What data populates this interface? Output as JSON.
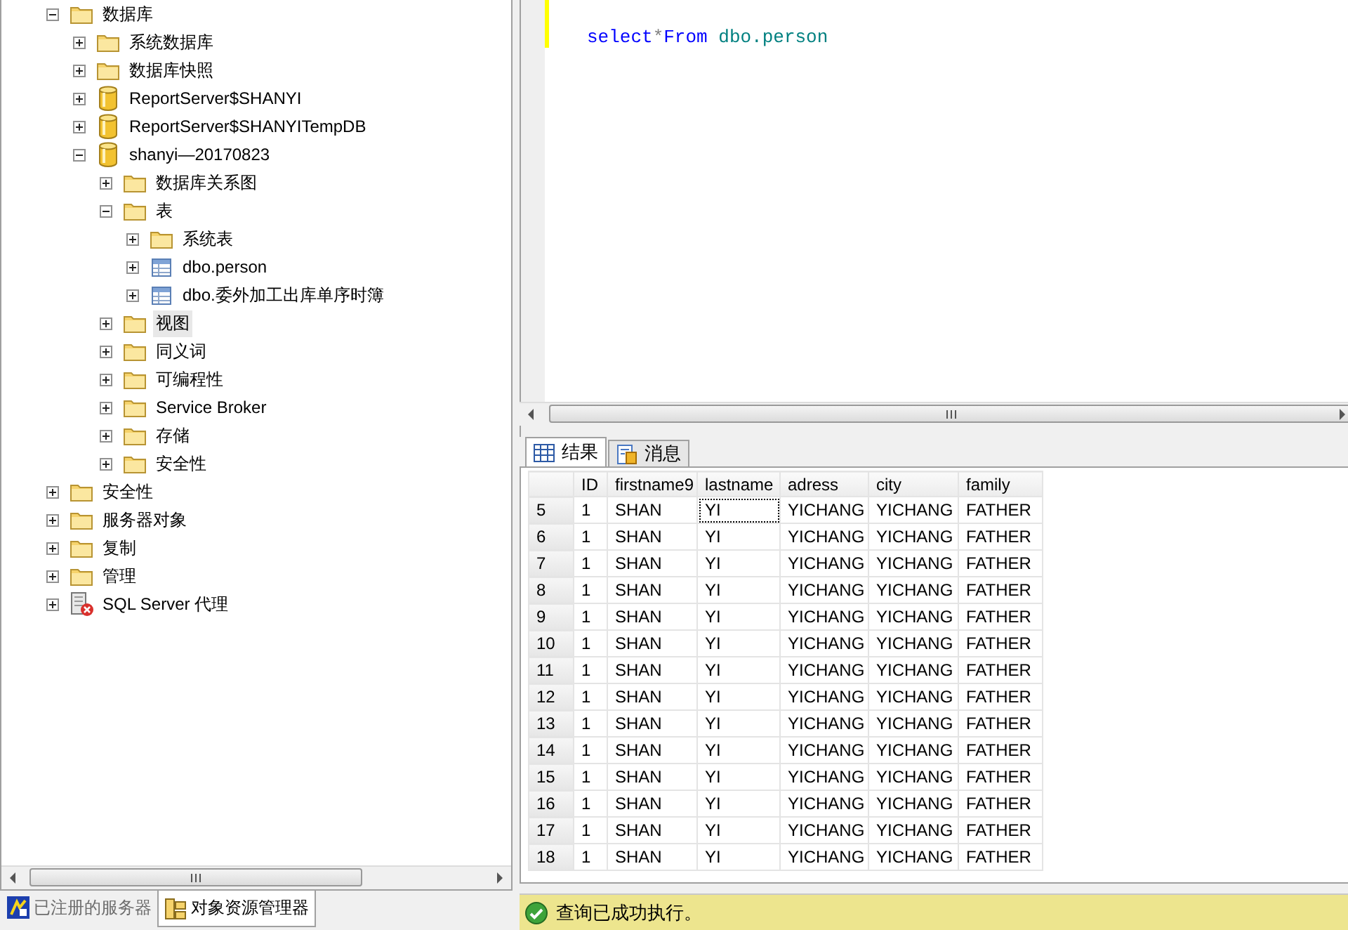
{
  "object_explorer": {
    "tree": [
      {
        "label": "数据库",
        "kind": "folder",
        "expanded": true,
        "selected": false,
        "children": [
          {
            "label": "系统数据库",
            "kind": "folder",
            "expanded": false,
            "selected": false
          },
          {
            "label": "数据库快照",
            "kind": "folder",
            "expanded": false,
            "selected": false
          },
          {
            "label": "ReportServer$SHANYI",
            "kind": "database",
            "expanded": false,
            "selected": false
          },
          {
            "label": "ReportServer$SHANYITempDB",
            "kind": "database",
            "expanded": false,
            "selected": false
          },
          {
            "label": "shanyi—20170823",
            "kind": "database",
            "expanded": true,
            "selected": false,
            "children": [
              {
                "label": "数据库关系图",
                "kind": "folder",
                "expanded": false,
                "selected": false
              },
              {
                "label": "表",
                "kind": "folder",
                "expanded": true,
                "selected": false,
                "children": [
                  {
                    "label": "系统表",
                    "kind": "folder",
                    "expanded": false,
                    "selected": false
                  },
                  {
                    "label": "dbo.person",
                    "kind": "table",
                    "expanded": false,
                    "selected": false
                  },
                  {
                    "label": "dbo.委外加工出库单序时簿",
                    "kind": "table",
                    "expanded": false,
                    "selected": false
                  }
                ]
              },
              {
                "label": "视图",
                "kind": "folder",
                "expanded": false,
                "selected": true
              },
              {
                "label": "同义词",
                "kind": "folder",
                "expanded": false,
                "selected": false
              },
              {
                "label": "可编程性",
                "kind": "folder",
                "expanded": false,
                "selected": false
              },
              {
                "label": "Service Broker",
                "kind": "folder",
                "expanded": false,
                "selected": false
              },
              {
                "label": "存储",
                "kind": "folder",
                "expanded": false,
                "selected": false
              },
              {
                "label": "安全性",
                "kind": "folder",
                "expanded": false,
                "selected": false
              }
            ]
          }
        ]
      },
      {
        "label": "安全性",
        "kind": "folder",
        "expanded": false,
        "selected": false
      },
      {
        "label": "服务器对象",
        "kind": "folder",
        "expanded": false,
        "selected": false
      },
      {
        "label": "复制",
        "kind": "folder",
        "expanded": false,
        "selected": false
      },
      {
        "label": "管理",
        "kind": "folder",
        "expanded": false,
        "selected": false
      },
      {
        "label": "SQL Server 代理",
        "kind": "agent",
        "expanded": false,
        "selected": false
      }
    ]
  },
  "bottom_tabs": [
    {
      "label": "已注册的服务器",
      "kind": "servers",
      "selected": false
    },
    {
      "label": "对象资源管理器",
      "kind": "explorer",
      "selected": true
    }
  ],
  "editor": {
    "code": [
      {
        "text": "select",
        "kind": "keyword"
      },
      {
        "text": "*",
        "kind": "operator"
      },
      {
        "text": "From",
        "kind": "keyword"
      },
      {
        "text": "dbo.person",
        "kind": "identifier"
      }
    ]
  },
  "results": {
    "tabs": [
      {
        "label": "结果",
        "kind": "grid",
        "selected": true
      },
      {
        "label": "消息",
        "kind": "messages",
        "selected": false
      }
    ],
    "columns": [
      "ID",
      "firstname9",
      "lastname",
      "adress",
      "city",
      "family"
    ],
    "rows": [
      {
        "number": "5",
        "cells": [
          {
            "text": "1",
            "focused": false
          },
          {
            "text": "SHAN",
            "focused": false
          },
          {
            "text": "YI",
            "focused": true
          },
          {
            "text": "YICHANG",
            "focused": false
          },
          {
            "text": "YICHANG",
            "focused": false
          },
          {
            "text": "FATHER",
            "focused": false
          }
        ]
      },
      {
        "number": "6",
        "cells": [
          {
            "text": "1",
            "focused": false
          },
          {
            "text": "SHAN",
            "focused": false
          },
          {
            "text": "YI",
            "focused": false
          },
          {
            "text": "YICHANG",
            "focused": false
          },
          {
            "text": "YICHANG",
            "focused": false
          },
          {
            "text": "FATHER",
            "focused": false
          }
        ]
      },
      {
        "number": "7",
        "cells": [
          {
            "text": "1",
            "focused": false
          },
          {
            "text": "SHAN",
            "focused": false
          },
          {
            "text": "YI",
            "focused": false
          },
          {
            "text": "YICHANG",
            "focused": false
          },
          {
            "text": "YICHANG",
            "focused": false
          },
          {
            "text": "FATHER",
            "focused": false
          }
        ]
      },
      {
        "number": "8",
        "cells": [
          {
            "text": "1",
            "focused": false
          },
          {
            "text": "SHAN",
            "focused": false
          },
          {
            "text": "YI",
            "focused": false
          },
          {
            "text": "YICHANG",
            "focused": false
          },
          {
            "text": "YICHANG",
            "focused": false
          },
          {
            "text": "FATHER",
            "focused": false
          }
        ]
      },
      {
        "number": "9",
        "cells": [
          {
            "text": "1",
            "focused": false
          },
          {
            "text": "SHAN",
            "focused": false
          },
          {
            "text": "YI",
            "focused": false
          },
          {
            "text": "YICHANG",
            "focused": false
          },
          {
            "text": "YICHANG",
            "focused": false
          },
          {
            "text": "FATHER",
            "focused": false
          }
        ]
      },
      {
        "number": "10",
        "cells": [
          {
            "text": "1",
            "focused": false
          },
          {
            "text": "SHAN",
            "focused": false
          },
          {
            "text": "YI",
            "focused": false
          },
          {
            "text": "YICHANG",
            "focused": false
          },
          {
            "text": "YICHANG",
            "focused": false
          },
          {
            "text": "FATHER",
            "focused": false
          }
        ]
      },
      {
        "number": "11",
        "cells": [
          {
            "text": "1",
            "focused": false
          },
          {
            "text": "SHAN",
            "focused": false
          },
          {
            "text": "YI",
            "focused": false
          },
          {
            "text": "YICHANG",
            "focused": false
          },
          {
            "text": "YICHANG",
            "focused": false
          },
          {
            "text": "FATHER",
            "focused": false
          }
        ]
      },
      {
        "number": "12",
        "cells": [
          {
            "text": "1",
            "focused": false
          },
          {
            "text": "SHAN",
            "focused": false
          },
          {
            "text": "YI",
            "focused": false
          },
          {
            "text": "YICHANG",
            "focused": false
          },
          {
            "text": "YICHANG",
            "focused": false
          },
          {
            "text": "FATHER",
            "focused": false
          }
        ]
      },
      {
        "number": "13",
        "cells": [
          {
            "text": "1",
            "focused": false
          },
          {
            "text": "SHAN",
            "focused": false
          },
          {
            "text": "YI",
            "focused": false
          },
          {
            "text": "YICHANG",
            "focused": false
          },
          {
            "text": "YICHANG",
            "focused": false
          },
          {
            "text": "FATHER",
            "focused": false
          }
        ]
      },
      {
        "number": "14",
        "cells": [
          {
            "text": "1",
            "focused": false
          },
          {
            "text": "SHAN",
            "focused": false
          },
          {
            "text": "YI",
            "focused": false
          },
          {
            "text": "YICHANG",
            "focused": false
          },
          {
            "text": "YICHANG",
            "focused": false
          },
          {
            "text": "FATHER",
            "focused": false
          }
        ]
      },
      {
        "number": "15",
        "cells": [
          {
            "text": "1",
            "focused": false
          },
          {
            "text": "SHAN",
            "focused": false
          },
          {
            "text": "YI",
            "focused": false
          },
          {
            "text": "YICHANG",
            "focused": false
          },
          {
            "text": "YICHANG",
            "focused": false
          },
          {
            "text": "FATHER",
            "focused": false
          }
        ]
      },
      {
        "number": "16",
        "cells": [
          {
            "text": "1",
            "focused": false
          },
          {
            "text": "SHAN",
            "focused": false
          },
          {
            "text": "YI",
            "focused": false
          },
          {
            "text": "YICHANG",
            "focused": false
          },
          {
            "text": "YICHANG",
            "focused": false
          },
          {
            "text": "FATHER",
            "focused": false
          }
        ]
      },
      {
        "number": "17",
        "cells": [
          {
            "text": "1",
            "focused": false
          },
          {
            "text": "SHAN",
            "focused": false
          },
          {
            "text": "YI",
            "focused": false
          },
          {
            "text": "YICHANG",
            "focused": false
          },
          {
            "text": "YICHANG",
            "focused": false
          },
          {
            "text": "FATHER",
            "focused": false
          }
        ]
      },
      {
        "number": "18",
        "cells": [
          {
            "text": "1",
            "focused": false
          },
          {
            "text": "SHAN",
            "focused": false
          },
          {
            "text": "YI",
            "focused": false
          },
          {
            "text": "YICHANG",
            "focused": false
          },
          {
            "text": "YICHANG",
            "focused": false
          },
          {
            "text": "FATHER",
            "focused": false
          }
        ]
      }
    ]
  },
  "status_bar": {
    "kind": "success",
    "text": "查询已成功执行。"
  }
}
